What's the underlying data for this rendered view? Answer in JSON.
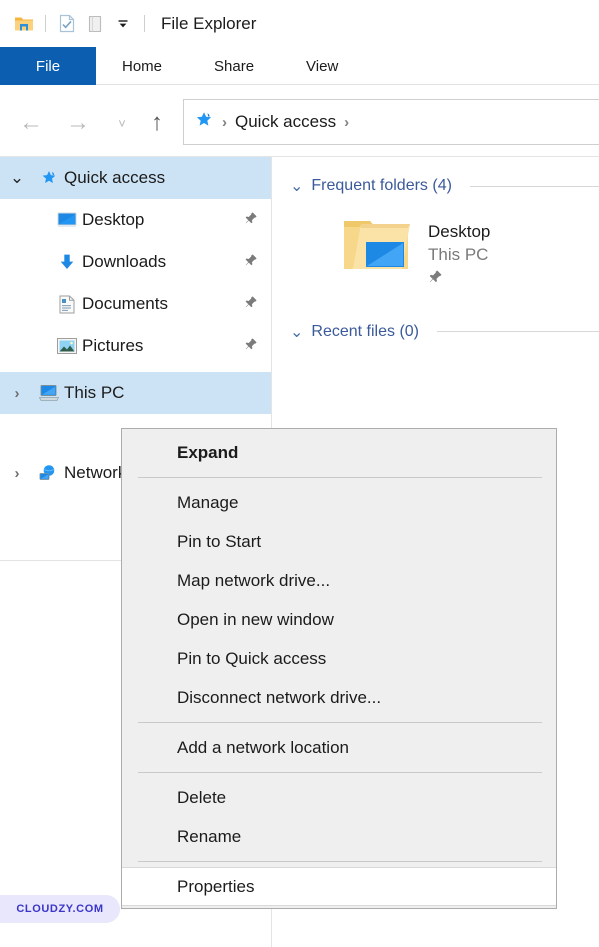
{
  "window": {
    "title": "File Explorer",
    "quick_access_toolbar": [
      {
        "name": "explorer-app-icon",
        "icon": "folder-app-icon"
      },
      {
        "name": "properties-icon",
        "icon": "checkbox-document-icon"
      },
      {
        "name": "new-folder-icon",
        "icon": "new-folder-icon"
      },
      {
        "name": "customize-toolbar-icon",
        "icon": "chevron-down-icon"
      }
    ]
  },
  "ribbon": {
    "tabs": [
      {
        "label": "File",
        "active": true
      },
      {
        "label": "Home",
        "active": false
      },
      {
        "label": "Share",
        "active": false
      },
      {
        "label": "View",
        "active": false
      }
    ]
  },
  "navigation": {
    "back": "←",
    "forward": "→",
    "history": "˅",
    "up": "↑",
    "address": {
      "icon": "quick-access-star-icon",
      "separator": "›",
      "crumb": "Quick access"
    }
  },
  "sidebar": {
    "items": [
      {
        "label": "Quick access",
        "icon": "quick-access-star-icon",
        "chevron": "⌄",
        "expanded": true,
        "selected": true,
        "child": false,
        "pinned": false
      },
      {
        "label": "Desktop",
        "icon": "desktop-monitor-icon",
        "chevron": "",
        "expanded": false,
        "selected": false,
        "child": true,
        "pinned": true
      },
      {
        "label": "Downloads",
        "icon": "downloads-arrow-icon",
        "chevron": "",
        "expanded": false,
        "selected": false,
        "child": true,
        "pinned": true
      },
      {
        "label": "Documents",
        "icon": "documents-page-icon",
        "chevron": "",
        "expanded": false,
        "selected": false,
        "child": true,
        "pinned": true
      },
      {
        "label": "Pictures",
        "icon": "pictures-photo-icon",
        "chevron": "",
        "expanded": false,
        "selected": false,
        "child": true,
        "pinned": true
      },
      {
        "label": "This PC",
        "icon": "this-pc-computer-icon",
        "chevron": "›",
        "expanded": false,
        "selected": true,
        "child": false,
        "pinned": false
      },
      {
        "label": "Network",
        "icon": "network-globe-icon",
        "chevron": "›",
        "expanded": false,
        "selected": false,
        "child": false,
        "pinned": false
      }
    ]
  },
  "content": {
    "groups": [
      {
        "label": "Frequent folders (4)",
        "chevron": "⌄"
      },
      {
        "label": "Recent files (0)",
        "chevron": "⌄"
      }
    ],
    "frequent_folders": [
      {
        "title": "Desktop",
        "subtitle": "This PC",
        "icon": "desktop-folder-icon",
        "pinned": true
      }
    ]
  },
  "context_menu": {
    "items": [
      {
        "label": "Expand",
        "bold": true,
        "hover": false,
        "separator_after": true
      },
      {
        "label": "Manage",
        "bold": false,
        "hover": false,
        "separator_after": false
      },
      {
        "label": "Pin to Start",
        "bold": false,
        "hover": false,
        "separator_after": false
      },
      {
        "label": "Map network drive...",
        "bold": false,
        "hover": false,
        "separator_after": false
      },
      {
        "label": "Open in new window",
        "bold": false,
        "hover": false,
        "separator_after": false
      },
      {
        "label": "Pin to Quick access",
        "bold": false,
        "hover": false,
        "separator_after": false
      },
      {
        "label": "Disconnect network drive...",
        "bold": false,
        "hover": false,
        "separator_after": true
      },
      {
        "label": "Add a network location",
        "bold": false,
        "hover": false,
        "separator_after": true
      },
      {
        "label": "Delete",
        "bold": false,
        "hover": false,
        "separator_after": false
      },
      {
        "label": "Rename",
        "bold": false,
        "hover": false,
        "separator_after": true
      },
      {
        "label": "Properties",
        "bold": false,
        "hover": true,
        "separator_after": false
      }
    ]
  },
  "watermark": {
    "text": "CLOUDZY.COM"
  },
  "colors": {
    "file_tab_blue": "#0b5eb0",
    "selection_blue": "#cce3f5",
    "group_header_blue": "#3b5a9a",
    "menu_background": "#efefef",
    "watermark_bg": "#e8e7fb",
    "watermark_fg": "#3b35c9"
  }
}
